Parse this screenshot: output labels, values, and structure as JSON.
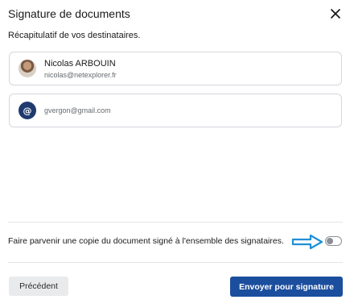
{
  "dialog": {
    "title": "Signature de documents",
    "close_icon": "close-icon",
    "subtitle": "Récapitulatif de vos destinataires."
  },
  "recipients": [
    {
      "name": "Nicolas ARBOUIN",
      "email": "nicolas@netexplorer.fr",
      "avatar": "user-photo"
    },
    {
      "name": "",
      "email": "gvergon@gmail.com",
      "avatar": "at-sign-icon",
      "avatar_text": "@"
    }
  ],
  "copy_option": {
    "label": "Faire parvenir une copie du document signé à l'ensemble des signataires.",
    "enabled": false,
    "annotation": "arrow-right-icon"
  },
  "footer": {
    "prev_label": "Précédent",
    "send_label": "Envoyer pour signature"
  },
  "colors": {
    "primary": "#1c4e9e",
    "annotation_arrow": "#1e90d6",
    "secondary_button": "#e9eaec",
    "border": "#d4d7dc"
  }
}
